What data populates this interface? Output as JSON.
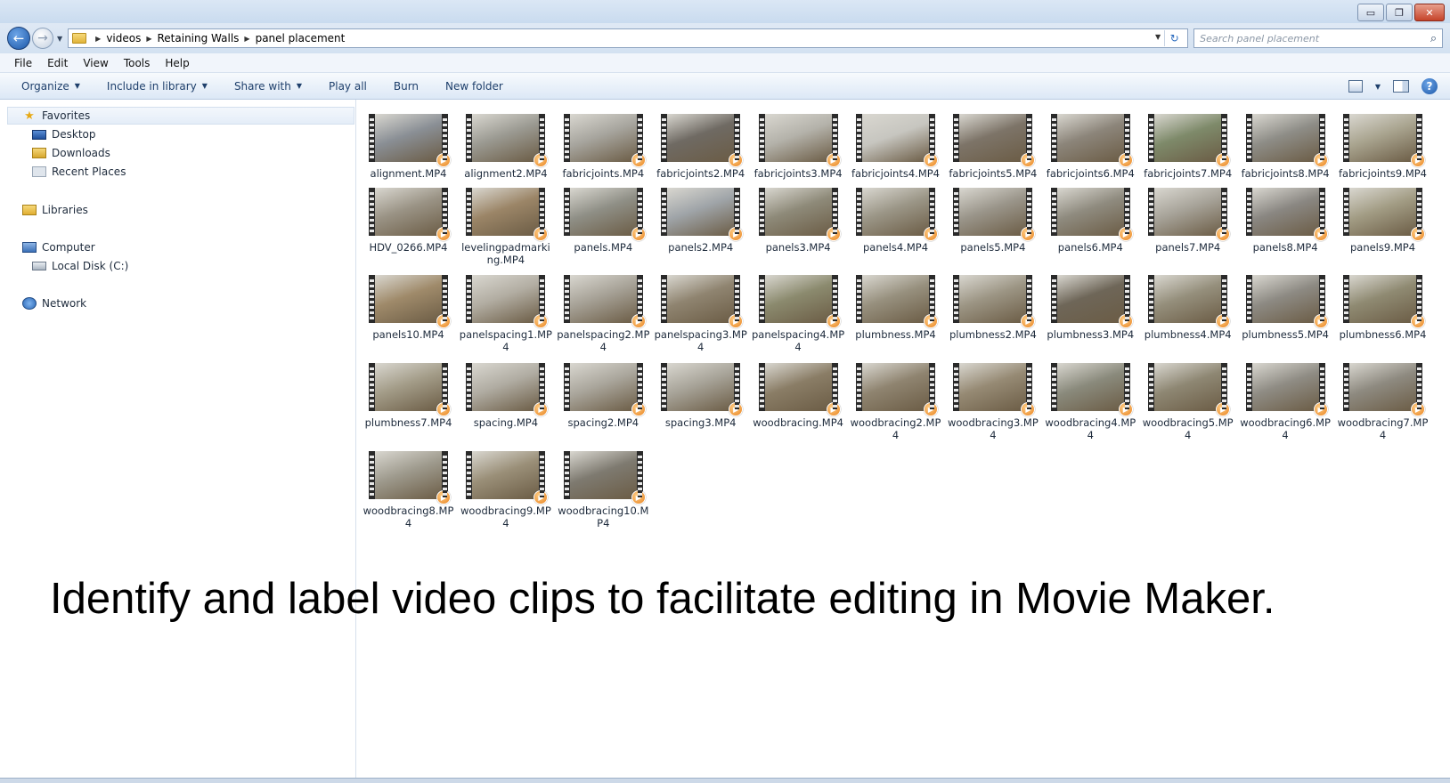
{
  "window": {
    "minimize_icon": "minimize-icon",
    "maximize_icon": "restore-icon",
    "close_icon": "close-icon",
    "min_glyph": "▭",
    "max_glyph": "❐",
    "close_glyph": "✕"
  },
  "address": {
    "breadcrumbs": [
      "videos",
      "Retaining Walls",
      "panel placement"
    ],
    "search_placeholder": "Search panel placement",
    "back_glyph": "←",
    "forward_glyph": "→",
    "refresh_glyph": "↻",
    "search_glyph": "⌕"
  },
  "menu": [
    "File",
    "Edit",
    "View",
    "Tools",
    "Help"
  ],
  "commands": [
    {
      "label": "Organize",
      "dropdown": true
    },
    {
      "label": "Include in library",
      "dropdown": true
    },
    {
      "label": "Share with",
      "dropdown": true
    },
    {
      "label": "Play all",
      "dropdown": false
    },
    {
      "label": "Burn",
      "dropdown": false
    },
    {
      "label": "New folder",
      "dropdown": false
    }
  ],
  "help_glyph": "?",
  "nav": {
    "favorites": "Favorites",
    "desktop": "Desktop",
    "downloads": "Downloads",
    "recent": "Recent Places",
    "libraries": "Libraries",
    "computer": "Computer",
    "local_disk": "Local Disk (C:)",
    "network": "Network"
  },
  "files": [
    {
      "name": "alignment.MP4",
      "tone": "#8a8f95"
    },
    {
      "name": "alignment2.MP4",
      "tone": "#9b9a92"
    },
    {
      "name": "fabricjoints.MP4",
      "tone": "#a7a59e"
    },
    {
      "name": "fabricjoints2.MP4",
      "tone": "#6f6a63"
    },
    {
      "name": "fabricjoints3.MP4",
      "tone": "#b4b2aa"
    },
    {
      "name": "fabricjoints4.MP4",
      "tone": "#c7c6c0"
    },
    {
      "name": "fabricjoints5.MP4",
      "tone": "#7d7468"
    },
    {
      "name": "fabricjoints6.MP4",
      "tone": "#8c857a"
    },
    {
      "name": "fabricjoints7.MP4",
      "tone": "#7e8a6a"
    },
    {
      "name": "fabricjoints8.MP4",
      "tone": "#8e8d87"
    },
    {
      "name": "fabricjoints9.MP4",
      "tone": "#a9a48f"
    },
    {
      "name": "HDV_0266.MP4",
      "tone": "#9a9385"
    },
    {
      "name": "levelingpadmarking.MP4",
      "tone": "#9b8567"
    },
    {
      "name": "panels.MP4",
      "tone": "#8f8f86"
    },
    {
      "name": "panels2.MP4",
      "tone": "#9fa4a8"
    },
    {
      "name": "panels3.MP4",
      "tone": "#8e8a79"
    },
    {
      "name": "panels4.MP4",
      "tone": "#9b9687"
    },
    {
      "name": "panels5.MP4",
      "tone": "#9a958a"
    },
    {
      "name": "panels6.MP4",
      "tone": "#8f8b7f"
    },
    {
      "name": "panels7.MP4",
      "tone": "#a7a399"
    },
    {
      "name": "panels8.MP4",
      "tone": "#8a8782"
    },
    {
      "name": "panels9.MP4",
      "tone": "#a29c84"
    },
    {
      "name": "panels10.MP4",
      "tone": "#9f8a6a"
    },
    {
      "name": "panelspacing1.MP4",
      "tone": "#b2ada2"
    },
    {
      "name": "panelspacing2.MP4",
      "tone": "#a6a196"
    },
    {
      "name": "panelspacing3.MP4",
      "tone": "#8f8470"
    },
    {
      "name": "panelspacing4.MP4",
      "tone": "#8b8a6e"
    },
    {
      "name": "plumbness.MP4",
      "tone": "#97907e"
    },
    {
      "name": "plumbness2.MP4",
      "tone": "#9c9584"
    },
    {
      "name": "plumbness3.MP4",
      "tone": "#6e6658"
    },
    {
      "name": "plumbness4.MP4",
      "tone": "#958f7c"
    },
    {
      "name": "plumbness5.MP4",
      "tone": "#8d8a83"
    },
    {
      "name": "plumbness6.MP4",
      "tone": "#8f8a72"
    },
    {
      "name": "plumbness7.MP4",
      "tone": "#a39c88"
    },
    {
      "name": "spacing.MP4",
      "tone": "#b0aca2"
    },
    {
      "name": "spacing2.MP4",
      "tone": "#aaa69c"
    },
    {
      "name": "spacing3.MP4",
      "tone": "#a7a398"
    },
    {
      "name": "woodbracing.MP4",
      "tone": "#8a7d66"
    },
    {
      "name": "woodbracing2.MP4",
      "tone": "#8f8470"
    },
    {
      "name": "woodbracing3.MP4",
      "tone": "#968a74"
    },
    {
      "name": "woodbracing4.MP4",
      "tone": "#8a8a7c"
    },
    {
      "name": "woodbracing5.MP4",
      "tone": "#8e8773"
    },
    {
      "name": "woodbracing6.MP4",
      "tone": "#8f8c84"
    },
    {
      "name": "woodbracing7.MP4",
      "tone": "#8e8a80"
    },
    {
      "name": "woodbracing8.MP4",
      "tone": "#9e9a8d"
    },
    {
      "name": "woodbracing9.MP4",
      "tone": "#9a8f78"
    },
    {
      "name": "woodbracing10.MP4",
      "tone": "#7e7a70"
    }
  ],
  "caption": "Identify and label video clips to facilitate editing in Movie Maker."
}
